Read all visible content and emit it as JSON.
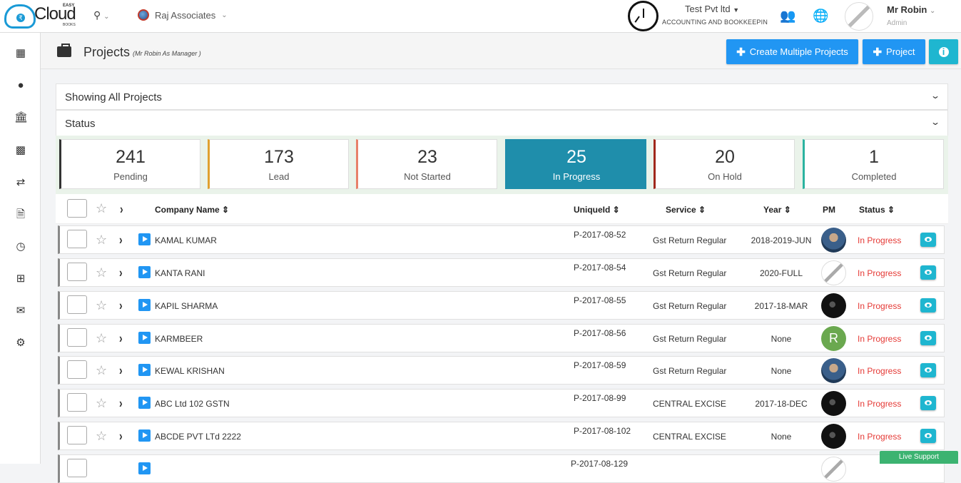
{
  "logo": {
    "easy": "EASY",
    "cloud": "Cloud",
    "books": "BOOKS"
  },
  "topbar": {
    "client_name": "Raj Associates",
    "company_name": "Test Pvt ltd",
    "company_sub": "ACCOUNTING AND BOOKKEEPIN",
    "user_name": "Mr Robin",
    "user_role": "Admin"
  },
  "page": {
    "title": "Projects",
    "subtitle": "(Mr Robin As Manager )",
    "btn_multi": "Create Multiple Projects",
    "btn_project": "Project"
  },
  "filters": {
    "showing": "Showing All Projects",
    "status": "Status"
  },
  "cards": [
    {
      "count": "241",
      "label": "Pending",
      "color": "#333333"
    },
    {
      "count": "173",
      "label": "Lead",
      "color": "#e0a030"
    },
    {
      "count": "23",
      "label": "Not Started",
      "color": "#e8806a"
    },
    {
      "count": "25",
      "label": "In Progress",
      "color": "#1f8eab"
    },
    {
      "count": "20",
      "label": "On Hold",
      "color": "#a0281c"
    },
    {
      "count": "1",
      "label": "Completed",
      "color": "#2bb3a0"
    }
  ],
  "table": {
    "headers": {
      "company": "Company Name",
      "unique": "UniqueId",
      "service": "Service",
      "year": "Year",
      "pm": "PM",
      "status": "Status"
    },
    "rows": [
      {
        "company": "KAMAL KUMAR",
        "unique": "P-2017-08-52",
        "service": "Gst Return Regular",
        "year": "2018-2019-JUN",
        "pm": "photo",
        "status": "In Progress"
      },
      {
        "company": "KANTA RANI",
        "unique": "P-2017-08-54",
        "service": "Gst Return Regular",
        "year": "2020-FULL",
        "pm": "sketch",
        "status": "In Progress"
      },
      {
        "company": "KAPIL SHARMA",
        "unique": "P-2017-08-55",
        "service": "Gst Return Regular",
        "year": "2017-18-MAR",
        "pm": "dark",
        "status": "In Progress"
      },
      {
        "company": "KARMBEER",
        "unique": "P-2017-08-56",
        "service": "Gst Return Regular",
        "year": "None",
        "pm_initial": "R",
        "status": "In Progress"
      },
      {
        "company": "KEWAL KRISHAN",
        "unique": "P-2017-08-59",
        "service": "Gst Return Regular",
        "year": "None",
        "pm": "photo",
        "status": "In Progress"
      },
      {
        "company": "ABC Ltd 102 GSTN",
        "unique": "P-2017-08-99",
        "service": "CENTRAL EXCISE",
        "year": "2017-18-DEC",
        "pm": "dark",
        "status": "In Progress"
      },
      {
        "company": "ABCDE PVT LTd 2222",
        "unique": "P-2017-08-102",
        "service": "CENTRAL EXCISE",
        "year": "None",
        "pm": "dark",
        "status": "In Progress"
      }
    ],
    "partial_unique": "P-2017-08-129"
  },
  "live_support": "Live Support"
}
